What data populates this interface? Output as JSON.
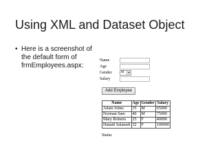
{
  "slide": {
    "title": "Using XML and Dataset Object",
    "bullet": "Here is a screenshot of the default form of frmEmployees.aspx:"
  },
  "form": {
    "fields": [
      {
        "label": "Name",
        "value": ""
      },
      {
        "label": "Age",
        "value": ""
      },
      {
        "label": "Gender",
        "value": "M"
      },
      {
        "label": "Salary",
        "value": ""
      }
    ],
    "add_button_label": "Add Employee",
    "status_label": "Status"
  },
  "table": {
    "headers": [
      "Name",
      "Age",
      "Gender",
      "Salary"
    ],
    "rows": [
      [
        "Adam Johns",
        "35",
        "M",
        "65000"
      ],
      [
        "Norman Sam",
        "40",
        "M",
        "75000"
      ],
      [
        "Mary Roberts",
        "25",
        "F",
        "40000"
      ],
      [
        "Hanadi Salameh",
        "32",
        "F",
        "100000"
      ]
    ]
  }
}
